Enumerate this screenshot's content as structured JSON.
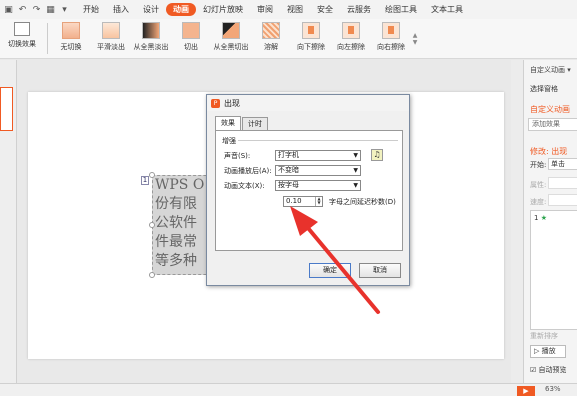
{
  "quick_access": [
    "▣",
    "↶",
    "↷",
    "▦",
    "▾"
  ],
  "menu": {
    "tabs": [
      {
        "label": "开始",
        "active": false
      },
      {
        "label": "插入",
        "active": false
      },
      {
        "label": "设计",
        "active": false
      },
      {
        "label": "动画",
        "active": true
      },
      {
        "label": "幻灯片放映",
        "active": false
      },
      {
        "label": "审阅",
        "active": false
      },
      {
        "label": "视图",
        "active": false
      },
      {
        "label": "安全",
        "active": false
      },
      {
        "label": "云服务",
        "active": false
      },
      {
        "label": "绘图工具",
        "active": false
      },
      {
        "label": "文本工具",
        "active": false
      }
    ]
  },
  "ribbon": {
    "switch_effect": "切换效果",
    "effects": [
      "无切换",
      "平滑淡出",
      "从全黑淡出",
      "切出",
      "从全黑切出",
      "溶解",
      "向下擦除",
      "向左擦除",
      "向右擦除"
    ]
  },
  "slide": {
    "textbox_lines": [
      "WPS O",
      "份有限",
      "公软件",
      "件最常",
      "等多种"
    ],
    "anim_number": "1"
  },
  "dialog": {
    "title": "出现",
    "tabs": [
      {
        "label": "效果",
        "active": true
      },
      {
        "label": "计时",
        "active": false
      }
    ],
    "group_label": "增强",
    "fields": {
      "sound_label": "声音(S):",
      "sound_value": "打字机",
      "after_label": "动画播放后(A):",
      "after_value": "不变暗",
      "text_label": "动画文本(X):",
      "text_value": "按字母",
      "delay_value": "0.10",
      "delay_label": "字母之间延迟秒数(D)"
    },
    "ok_label": "确定",
    "cancel_label": "取消"
  },
  "right_pane": {
    "title": "自定义动画 ▾",
    "select_pane": "选择窗格",
    "custom_anim": "自定义动画",
    "add_effect": "添加效果",
    "modify": "修改: 出现",
    "start_label": "开始:",
    "start_value": "单击",
    "property_label": "属性:",
    "speed_label": "速度:",
    "list_item": "1",
    "reorder": "重新排序",
    "play": "播放",
    "auto_preview": "自动预览"
  },
  "status": {
    "zoom": "63%"
  },
  "colors": {
    "accent": "#f05a23",
    "arrow": "#e8322c"
  },
  "icons": [
    "undo-icon",
    "redo-icon",
    "sound-icon",
    "spin-up-icon",
    "spin-down-icon",
    "play-icon",
    "dropdown-arrow-icon"
  ]
}
